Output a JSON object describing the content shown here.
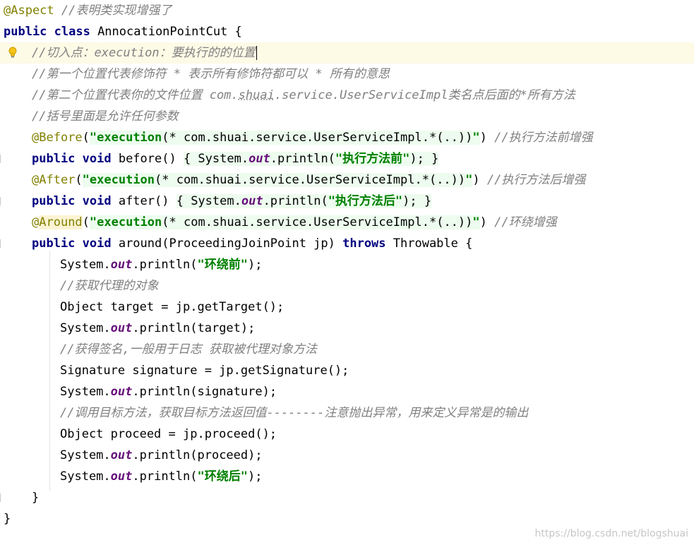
{
  "editor": {
    "lines": [
      {
        "parts": [
          {
            "t": "@Aspect",
            "c": "ann"
          },
          {
            "t": " //表明类实现增强了",
            "c": "cm"
          }
        ]
      },
      {
        "parts": [
          {
            "t": "public class",
            "c": "kw"
          },
          {
            "t": " AnnocationPointCut {",
            "c": ""
          }
        ]
      },
      {
        "parts": [
          {
            "t": "//切入点：execution：要执行的的位置",
            "c": "cm"
          }
        ]
      },
      {
        "parts": [
          {
            "t": "//第一个位置代表修饰符 * 表示所有修饰符都可以 * 所有的意思",
            "c": "cm"
          }
        ]
      },
      {
        "parts": [
          {
            "t": "//第二个位置代表你的文件位置 com.",
            "c": "cm"
          },
          {
            "t": "shuai",
            "c": "cm squig"
          },
          {
            "t": ".service.UserServiceImpl类名点后面的*所有方法",
            "c": "cm"
          }
        ]
      },
      {
        "parts": [
          {
            "t": "//括号里面是允许任何参数",
            "c": "cm"
          }
        ]
      },
      {
        "parts": [
          {
            "t": "@Before",
            "c": "ann"
          },
          {
            "t": "(",
            "c": ""
          },
          {
            "t": "\"execution",
            "c": "str hl"
          },
          {
            "t": "(* com.shuai.service.UserServiceImpl.*(..))",
            "c": "hl"
          },
          {
            "t": "\"",
            "c": "str hl"
          },
          {
            "t": ") ",
            "c": ""
          },
          {
            "t": "//执行方法前增强",
            "c": "cm"
          }
        ]
      },
      {
        "parts": [
          {
            "t": "public void",
            "c": "kw"
          },
          {
            "t": " before() ",
            "c": ""
          },
          {
            "t": "{ System.",
            "c": "hl"
          },
          {
            "t": "out",
            "c": "fld hl"
          },
          {
            "t": ".println(",
            "c": "hl"
          },
          {
            "t": "\"执行方法前\"",
            "c": "str hl"
          },
          {
            "t": "); }",
            "c": "hl"
          }
        ]
      },
      {
        "parts": [
          {
            "t": "@After",
            "c": "ann"
          },
          {
            "t": "(",
            "c": ""
          },
          {
            "t": "\"execution",
            "c": "str hl"
          },
          {
            "t": "(* com.shuai.service.UserServiceImpl.*(..))",
            "c": "hl"
          },
          {
            "t": "\"",
            "c": "str hl"
          },
          {
            "t": ") ",
            "c": ""
          },
          {
            "t": "//执行方法后增强",
            "c": "cm"
          }
        ]
      },
      {
        "parts": [
          {
            "t": "public void",
            "c": "kw"
          },
          {
            "t": " after() ",
            "c": ""
          },
          {
            "t": "{ System.",
            "c": "hl"
          },
          {
            "t": "out",
            "c": "fld hl"
          },
          {
            "t": ".println(",
            "c": "hl"
          },
          {
            "t": "\"执行方法后\"",
            "c": "str hl"
          },
          {
            "t": "); }",
            "c": "hl"
          }
        ]
      },
      {
        "parts": [
          {
            "t": "@",
            "c": "ann"
          },
          {
            "t": "Around",
            "c": "ann hl-around"
          },
          {
            "t": "(",
            "c": ""
          },
          {
            "t": "\"execution",
            "c": "str hl"
          },
          {
            "t": "(* com.shuai.service.UserServiceImpl.*(..))",
            "c": "hl"
          },
          {
            "t": "\"",
            "c": "str hl"
          },
          {
            "t": ") ",
            "c": ""
          },
          {
            "t": "//环绕增强",
            "c": "cm"
          }
        ]
      },
      {
        "parts": [
          {
            "t": "public void",
            "c": "kw"
          },
          {
            "t": " around(ProceedingJoinPoint jp) ",
            "c": ""
          },
          {
            "t": "throws",
            "c": "kw"
          },
          {
            "t": " Throwable {",
            "c": ""
          }
        ]
      },
      {
        "parts": [
          {
            "t": "System.",
            "c": ""
          },
          {
            "t": "out",
            "c": "fld"
          },
          {
            "t": ".println(",
            "c": ""
          },
          {
            "t": "\"环绕前\"",
            "c": "str"
          },
          {
            "t": ");",
            "c": ""
          }
        ]
      },
      {
        "parts": [
          {
            "t": "//获取代理的对象",
            "c": "cm"
          }
        ]
      },
      {
        "parts": [
          {
            "t": "Object target = jp.getTarget();",
            "c": ""
          }
        ]
      },
      {
        "parts": [
          {
            "t": "System.",
            "c": ""
          },
          {
            "t": "out",
            "c": "fld"
          },
          {
            "t": ".println(target);",
            "c": ""
          }
        ]
      },
      {
        "parts": [
          {
            "t": "//获得签名,一般用于日志 获取被代理对象方法",
            "c": "cm"
          }
        ]
      },
      {
        "parts": [
          {
            "t": "Signature signature = jp.getSignature();",
            "c": ""
          }
        ]
      },
      {
        "parts": [
          {
            "t": "System.",
            "c": ""
          },
          {
            "t": "out",
            "c": "fld"
          },
          {
            "t": ".println(signature);",
            "c": ""
          }
        ]
      },
      {
        "parts": [
          {
            "t": "//调用目标方法，获取目标方法返回值--------注意抛出异常，用来定义异常是的输出",
            "c": "cm"
          }
        ]
      },
      {
        "parts": [
          {
            "t": "Object proceed = jp.proceed();",
            "c": ""
          }
        ]
      },
      {
        "parts": [
          {
            "t": "System.",
            "c": ""
          },
          {
            "t": "out",
            "c": "fld"
          },
          {
            "t": ".println(proceed);",
            "c": ""
          }
        ]
      },
      {
        "parts": [
          {
            "t": "System.",
            "c": ""
          },
          {
            "t": "out",
            "c": "fld"
          },
          {
            "t": ".println(",
            "c": ""
          },
          {
            "t": "\"环绕后\"",
            "c": "str"
          },
          {
            "t": ");",
            "c": ""
          }
        ]
      },
      {
        "parts": [
          {
            "t": "}",
            "c": ""
          }
        ]
      },
      {
        "parts": [
          {
            "t": "}",
            "c": ""
          }
        ]
      }
    ],
    "current_line": 2,
    "intention_icon": "lightbulb-icon"
  },
  "watermark": "https://blog.csdn.net/blogshuai",
  "colors": {
    "keyword": "#000080",
    "annotation": "#808000",
    "comment": "#808080",
    "string": "#008000",
    "static_field": "#660e7a",
    "current_line_bg": "#fdfae6",
    "highlight_bg": "#edfcee"
  }
}
